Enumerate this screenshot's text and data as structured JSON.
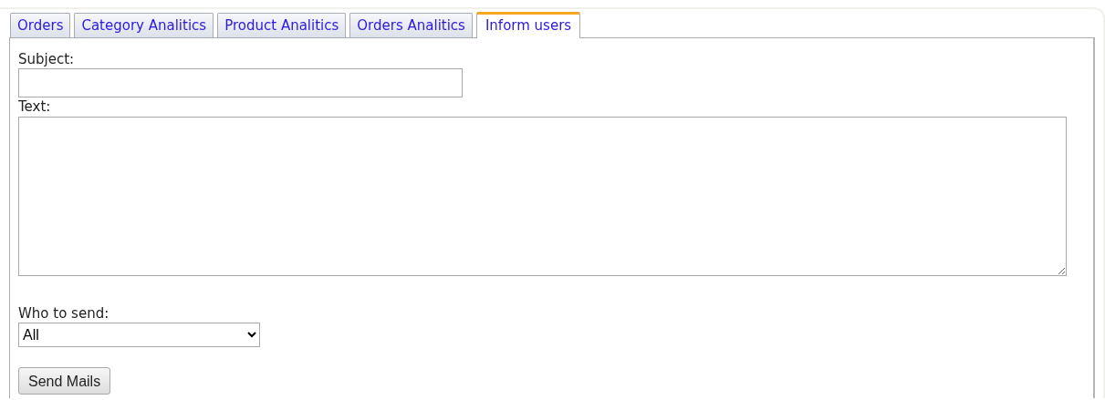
{
  "tabs": [
    {
      "label": "Orders",
      "selected": false
    },
    {
      "label": "Category Analitics",
      "selected": false
    },
    {
      "label": "Product Analitics",
      "selected": false
    },
    {
      "label": "Orders Analitics",
      "selected": false
    },
    {
      "label": "Inform users",
      "selected": true
    }
  ],
  "form": {
    "subject_label": "Subject:",
    "text_label": "Text:",
    "recipients_label": "Who to send:",
    "recipients_value": "All",
    "submit": "Send Mails"
  }
}
